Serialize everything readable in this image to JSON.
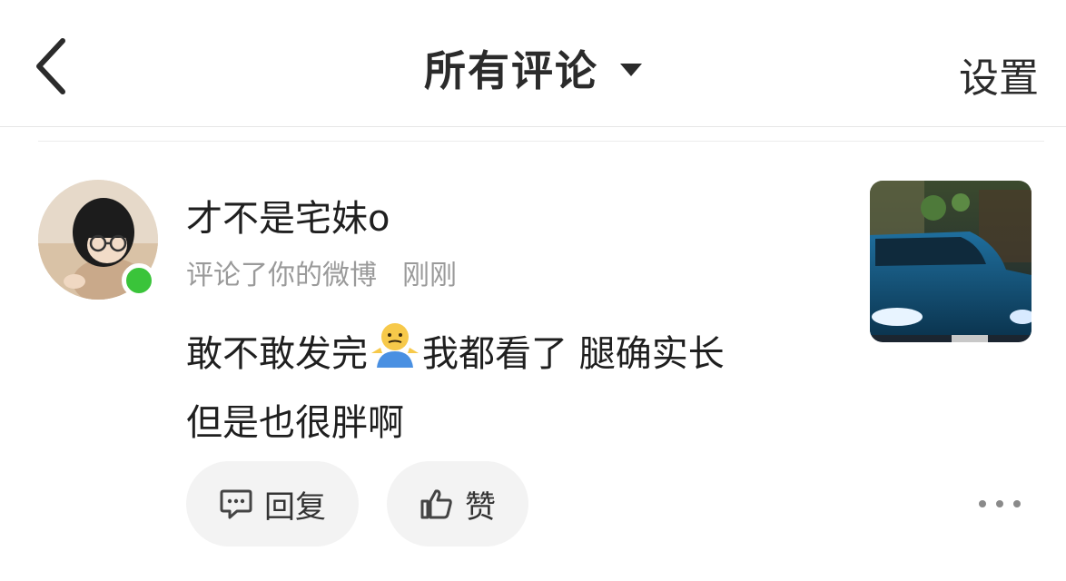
{
  "header": {
    "title": "所有评论",
    "settings_label": "设置"
  },
  "notification": {
    "username": "才不是宅妹o",
    "action": "评论了你的微博",
    "time": "刚刚",
    "comment_line1_a": "敢不敢发完",
    "comment_line1_b": "我都看了  腿确实长",
    "comment_line2": "但是也很胖啊",
    "online": true
  },
  "actions": {
    "reply_label": "回复",
    "like_label": "赞"
  },
  "colors": {
    "online_dot": "#3ac43a",
    "pill_bg": "#f3f3f3",
    "meta_text": "#9a9a9a"
  },
  "icons": {
    "back": "chevron-left-icon",
    "dropdown": "caret-down-icon",
    "reply": "comment-icon",
    "like": "thumbs-up-icon",
    "more": "more-horizontal-icon"
  }
}
